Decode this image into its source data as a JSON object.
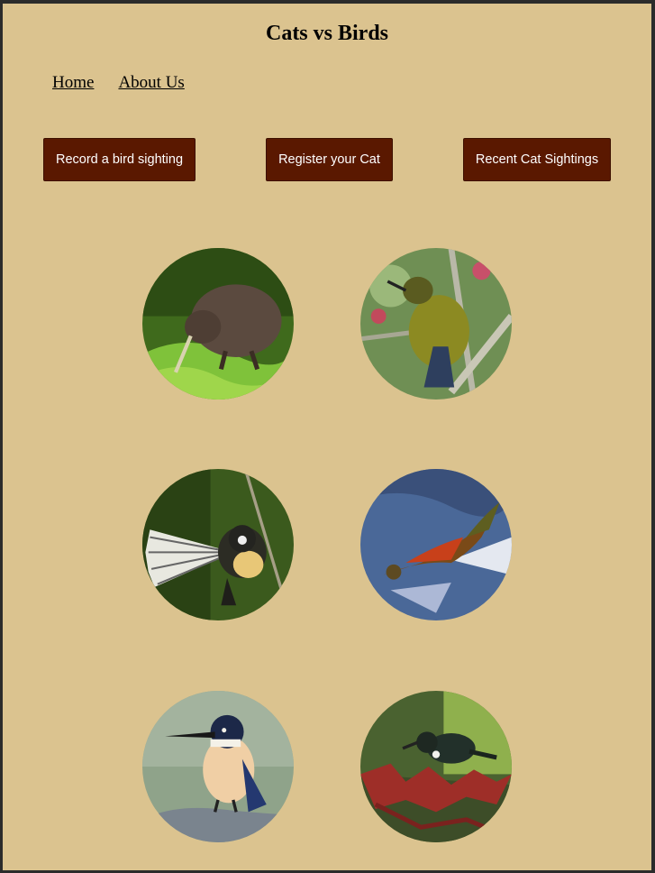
{
  "header": {
    "title": "Cats vs Birds"
  },
  "nav": {
    "home": "Home",
    "about": "About Us"
  },
  "actions": {
    "record_label": "Record a bird sighting",
    "register_label": "Register your Cat",
    "recent_label": "Recent Cat Sightings"
  },
  "gallery": {
    "birds": [
      "kiwi",
      "bellbird",
      "fantail",
      "kea",
      "kingfisher",
      "tui"
    ]
  },
  "colors": {
    "page_background": "#dbc38f",
    "button_background": "#5a1800",
    "button_text": "#ffffff",
    "frame": "#2b2b2b"
  }
}
